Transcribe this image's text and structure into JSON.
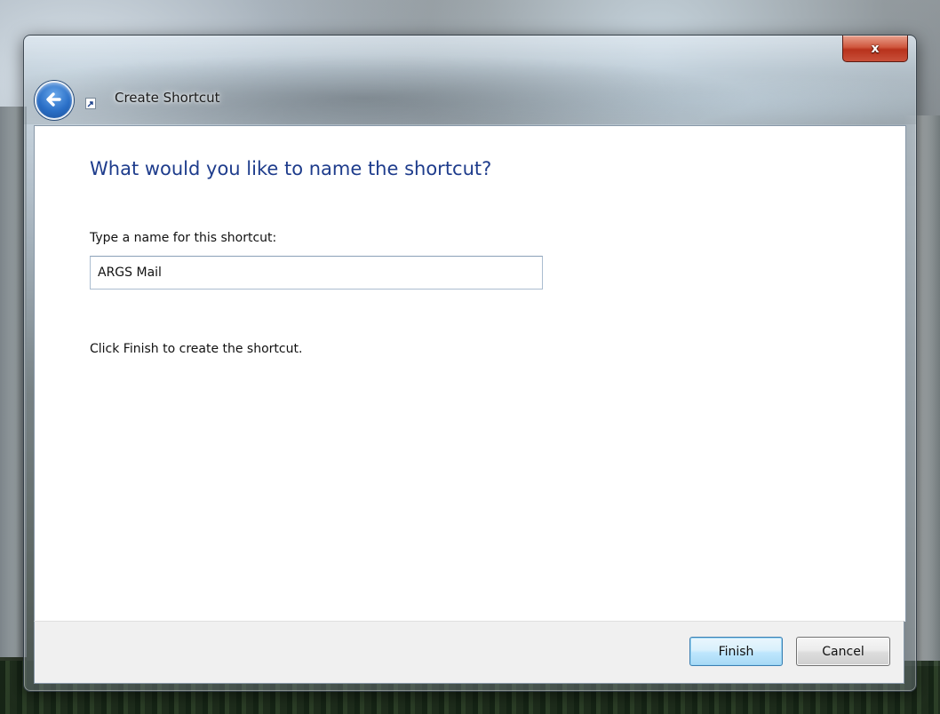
{
  "window": {
    "title": "Create Shortcut",
    "close_label": "x"
  },
  "main": {
    "heading": "What would you like to name the shortcut?",
    "name_label": "Type a name for this shortcut:",
    "name_value": "ARGS Mail",
    "hint": "Click Finish to create the shortcut."
  },
  "footer": {
    "finish_label": "Finish",
    "cancel_label": "Cancel"
  },
  "icons": {
    "back": "back-arrow-icon",
    "shortcut": "shortcut-icon",
    "close": "close-icon"
  },
  "colors": {
    "heading": "#1e3c8c",
    "close_button": "#c9503a",
    "back_button": "#2a6fc7",
    "default_button_border": "#3c7fb1"
  }
}
